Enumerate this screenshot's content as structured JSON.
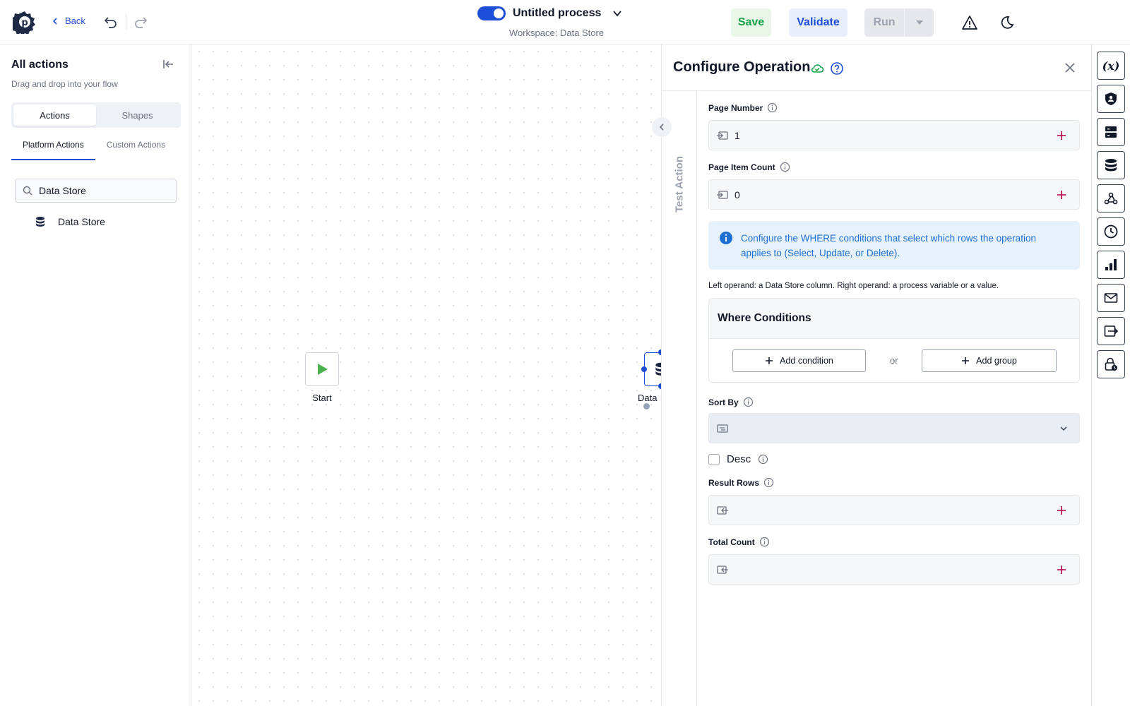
{
  "header": {
    "back_label": "Back",
    "process_title": "Untitled process",
    "workspace": "Workspace: Data Store",
    "save_label": "Save",
    "validate_label": "Validate",
    "run_label": "Run",
    "process_enabled": true
  },
  "left_panel": {
    "title": "All actions",
    "subtitle": "Drag and drop into your flow",
    "segments": [
      "Actions",
      "Shapes"
    ],
    "active_segment": "Actions",
    "subtabs": [
      "Platform Actions",
      "Custom Actions"
    ],
    "active_subtab": "Platform Actions",
    "search_value": "Data Store",
    "results": [
      {
        "label": "Data Store",
        "icon": "database-icon"
      }
    ]
  },
  "canvas": {
    "start_label": "Start",
    "data_node_label": "Data"
  },
  "config": {
    "title": "Configure Operation",
    "test_action_label": "Test Action",
    "page_number_label": "Page Number",
    "page_number_value": "1",
    "page_item_count_label": "Page Item Count",
    "page_item_count_value": "0",
    "banner_text": "Configure the WHERE conditions that select which rows the operation applies to (Select, Update, or Delete).",
    "operand_note": "Left operand: a Data Store column. Right operand: a process variable or a value.",
    "where_title": "Where Conditions",
    "add_condition_label": "Add condition",
    "or_label": "or",
    "add_group_label": "Add group",
    "sort_by_label": "Sort By",
    "sort_by_value": "",
    "desc_label": "Desc",
    "desc_checked": false,
    "result_rows_label": "Result Rows",
    "result_rows_value": "",
    "total_count_label": "Total Count",
    "total_count_value": ""
  },
  "right_rail": {
    "icons": [
      "variable-icon",
      "shield-icon",
      "server-icon",
      "database-icon",
      "webhook-icon",
      "clock-icon",
      "chart-icon",
      "mail-icon",
      "export-icon",
      "lock-clock-icon"
    ]
  },
  "colors": {
    "accent": "#1d4ed8",
    "save_green": "#16a34a",
    "add_magenta": "#be185d",
    "info_blue": "#1d6fd1"
  }
}
